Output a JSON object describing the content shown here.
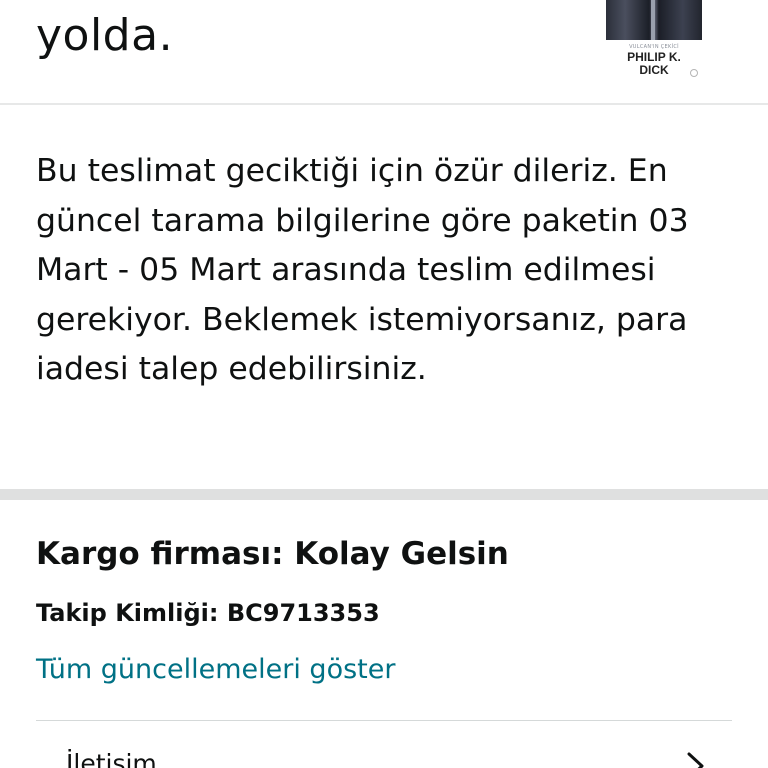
{
  "header": {
    "headline": "yolda."
  },
  "book": {
    "subtitle": "VULCAN'IN ÇEKİCİ",
    "author": "PHILIP K. DICK",
    "author_line1": "PHILIP K.",
    "author_line2": "DICK"
  },
  "notice": {
    "text": "Bu teslimat geciktiği için özür dileriz. En güncel tarama bilgilerine göre paketin 03 Mart - 05 Mart arasında teslim edilmesi gerekiyor. Beklemek istemiyorsanız, para iadesi talep edebilirsiniz."
  },
  "shipping": {
    "carrier": "Kargo firması: Kolay Gelsin",
    "tracking": "Takip Kimliği: BC9713353",
    "show_updates_link": "Tüm güncellemeleri göster"
  },
  "contact": {
    "label": "İletişim"
  },
  "colors": {
    "text": "#0f1111",
    "link": "#007185",
    "divider": "#dfe0e0"
  },
  "icons": {
    "contact_chevron": "chevron-right-icon"
  }
}
